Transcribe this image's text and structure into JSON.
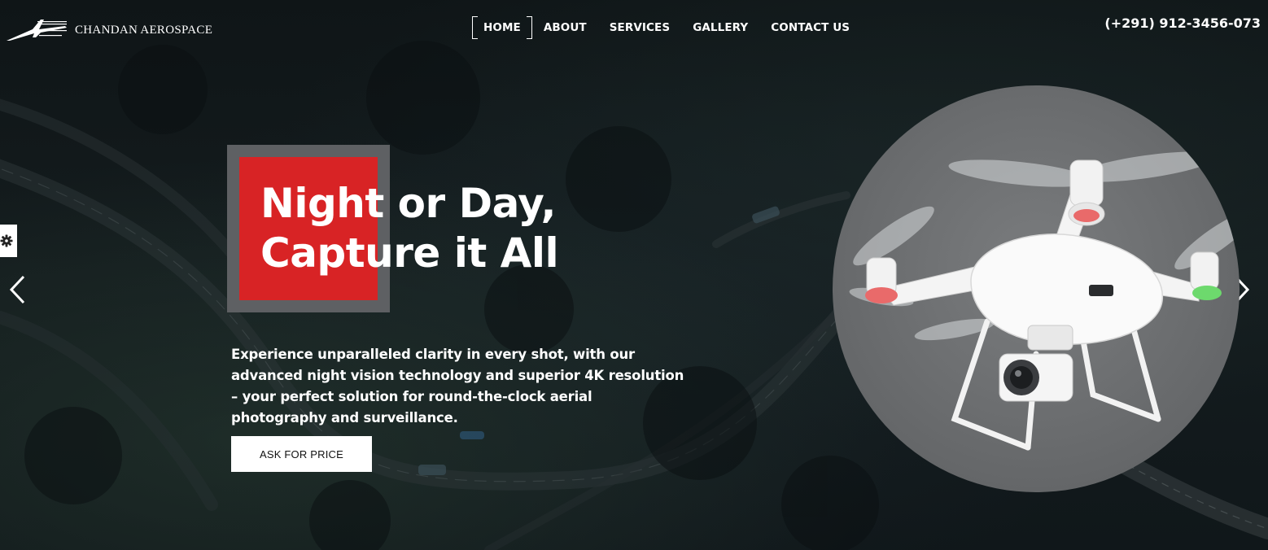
{
  "brand": {
    "name": "CHANDAN AEROSPACE",
    "logo_icon": "aircraft-logo-icon"
  },
  "nav": {
    "items": [
      {
        "label": "HOME",
        "active": true
      },
      {
        "label": "ABOUT",
        "active": false
      },
      {
        "label": "SERVICES",
        "active": false
      },
      {
        "label": "GALLERY",
        "active": false
      },
      {
        "label": "CONTACT US",
        "active": false
      }
    ]
  },
  "header": {
    "phone": "(+291) 912-3456-073"
  },
  "hero": {
    "headline_line1": "Night or Day,",
    "headline_line2": "Capture it All",
    "description": "Experience unparalleled clarity in every shot, with our advanced night vision technology and superior 4K resolution – your perfect solution for round-the-clock aerial photography and surveillance.",
    "cta_label": "ASK FOR PRICE",
    "image": "drone-icon"
  },
  "controls": {
    "settings_icon": "gear-icon",
    "prev_icon": "chevron-left-icon",
    "next_icon": "chevron-right-icon"
  },
  "colors": {
    "accent_red": "#d82325",
    "accent_gray": "#5e6063",
    "background": "#121a1c"
  }
}
